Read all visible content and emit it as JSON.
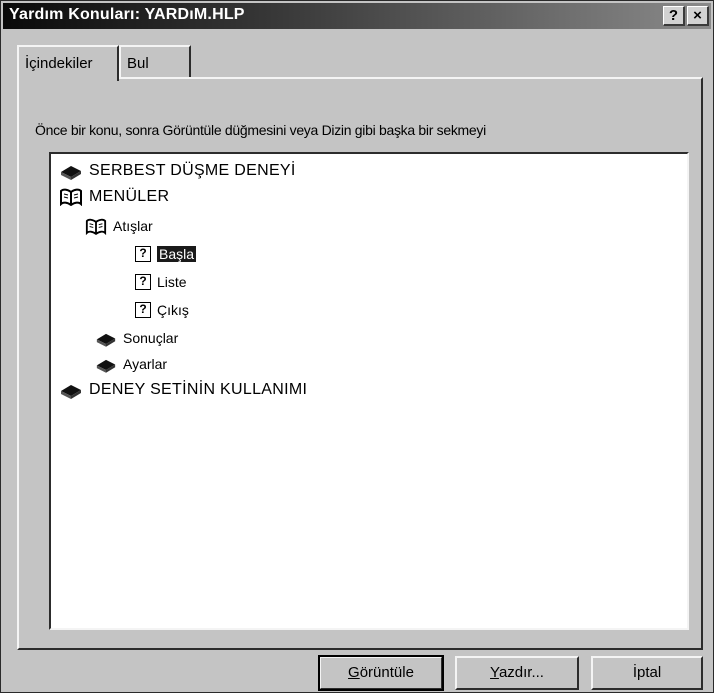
{
  "window": {
    "title": "Yardım Konuları: YARDıM.HLP",
    "help_button": "?",
    "close_button": "×"
  },
  "tabs": [
    {
      "label": "İçindekiler",
      "active": true
    },
    {
      "label": "Bul",
      "active": false
    }
  ],
  "instruction": "Önce bir konu, sonra Görüntüle düğmesini veya Dizin gibi başka bir sekmeyi",
  "tree": [
    {
      "label": "SERBEST DÜŞME DENEYİ",
      "icon": "closed-book-icon",
      "level": 0
    },
    {
      "label": "MENÜLER",
      "icon": "open-book-icon",
      "level": 0
    },
    {
      "label": "Atışlar",
      "icon": "open-book-icon",
      "level": 1
    },
    {
      "label": "Başla",
      "icon": "help-topic-icon",
      "level": 2,
      "selected": true
    },
    {
      "label": "Liste",
      "icon": "help-topic-icon",
      "level": 2
    },
    {
      "label": "Çıkış",
      "icon": "help-topic-icon",
      "level": 2
    },
    {
      "label": "Sonuçlar",
      "icon": "closed-book-icon",
      "level": 1
    },
    {
      "label": "Ayarlar",
      "icon": "closed-book-icon",
      "level": 1
    },
    {
      "label": "DENEY SETİNİN KULLANIMI",
      "icon": "closed-book-icon",
      "level": 0
    }
  ],
  "buttons": {
    "display": {
      "first": "G",
      "rest": "örüntüle"
    },
    "print": {
      "first": "Y",
      "rest": "azdır..."
    },
    "cancel": "İptal"
  },
  "colors": {
    "face": "#c4c4c4",
    "selection": "#1a1a1a"
  }
}
